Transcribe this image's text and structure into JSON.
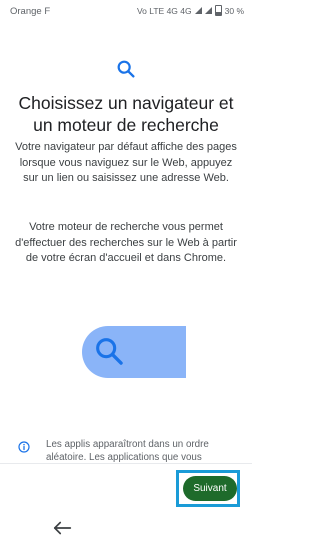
{
  "status_bar": {
    "carrier": "Orange F",
    "indicators": "Vo LTE 4G 4G",
    "battery": "30 %"
  },
  "main": {
    "title": "Choisissez un navigateur et un moteur de recherche",
    "paragraph_browser": "Votre navigateur par défaut affiche des pages lorsque vous naviguez sur le Web, appuyez sur un lien ou saisissez une adresse Web.",
    "paragraph_search": "Votre moteur de recherche vous permet d'effectuer des recherches sur le Web à partir de votre écran d'accueil et dans Chrome."
  },
  "info": {
    "text": "Les applis apparaîtront dans un ordre aléatoire. Les applications que vous"
  },
  "footer": {
    "next_label": "Suivant"
  },
  "icons": {
    "top": "search-icon",
    "illustration": "search-icon",
    "info": "info-icon",
    "back": "back-arrow-icon"
  },
  "colors": {
    "accent_blue": "#1a73e8",
    "illustration_blue": "#8ab4f8",
    "next_button": "#1e6b2b",
    "highlight_box": "#1a9bd7"
  }
}
